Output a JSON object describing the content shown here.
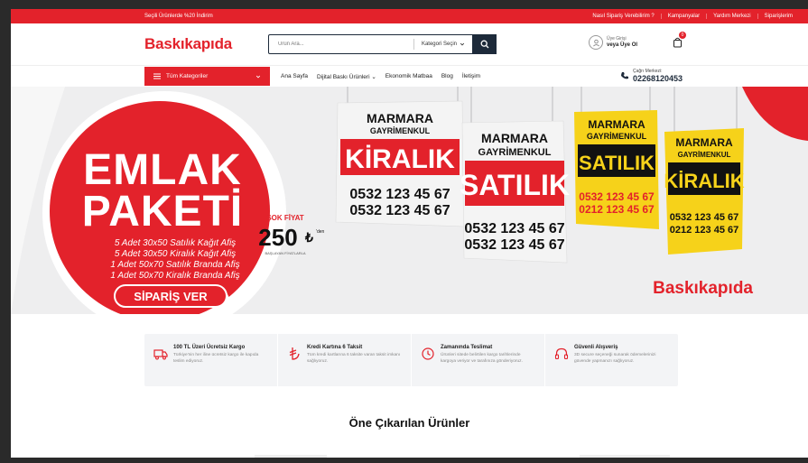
{
  "topbar": {
    "promo": "Seçili Ürünlerde %20 İndirim",
    "links": [
      "Nasıl Sipariş Verebilirim ?",
      "Kampanyalar",
      "Yardım Merkezi",
      "Siparişlerim"
    ]
  },
  "header": {
    "logo": "Baskıkapıda",
    "search_placeholder": "Ürün Ara...",
    "category_select": "Kategori Seçin",
    "user_line1": "Üye Girişi",
    "user_line2": "veya Üye Ol",
    "cart_count": "0"
  },
  "nav": {
    "all_categories": "Tüm Kategoriler",
    "links": [
      "Ana Sayfa",
      "Dijital Baskı Ürünleri",
      "Ekonomik Matbaa",
      "Blog",
      "İletişim"
    ],
    "phone_label": "Çağrı Merkezi:",
    "phone_number": "02268120453"
  },
  "hero": {
    "title_line1": "EMLAK",
    "title_line2": "PAKETİ",
    "items": [
      "5 Adet  30x50 Satılık Kağıt Afiş",
      "5 Adet 30x50 Kiralık Kağıt Afiş",
      "1 Adet 50x70 Satılık Branda Afiş",
      "1 Adet 50x70 Kiralık Branda Afiş"
    ],
    "cta": "SİPARİŞ VER",
    "price_label": "ŞOK FİYAT",
    "price": "250",
    "currency": "₺",
    "price_sub": "'den",
    "price_note": "BAŞLAYAN FİYATLARLA",
    "brand": "Baskıkapıda",
    "sign_company": [
      "MARMARA",
      "GAYRİMENKUL"
    ],
    "sign_kiralik": "KİRALIK",
    "sign_satilik": "SATILIK",
    "sign_phone1": "0532 123 45 67",
    "sign_phone2": "0212 123 45 67"
  },
  "features": [
    {
      "icon": "truck-icon",
      "title": "100 TL Üzeri Ücretsiz Kargo",
      "desc": "Türkiye'nin her iline ücretsiz kargo ile kapıda teslim ediyoruz."
    },
    {
      "icon": "lira-icon",
      "title": "Kredi Kartına 6 Taksit",
      "desc": "Tüm kredi kartlarına 6 taksite varan taksit imkanı sağlıyoruz."
    },
    {
      "icon": "clock-icon",
      "title": "Zamanında Teslimat",
      "desc": "Ürünleri sitede belirtilen kargo tarihlerinde kargoya veriyor ve tarafınıza gönderiyoruz."
    },
    {
      "icon": "headset-icon",
      "title": "Güvenli Alışveriş",
      "desc": "3D secure seçeneği sunarak ödemelerinizi güvende yapmanızı sağlıyoruz."
    }
  ],
  "section_title": "Öne Çıkarılan Ürünler",
  "colors": {
    "brand_red": "#e3222b",
    "navy": "#1d2a3a",
    "yellow": "#f6d21a"
  }
}
